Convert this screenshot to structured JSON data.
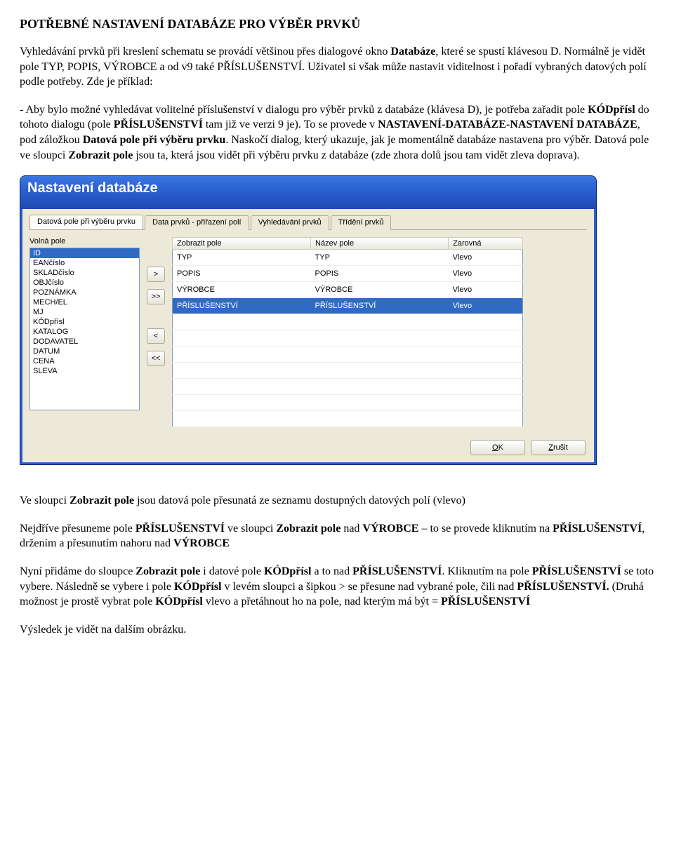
{
  "doc": {
    "title": "POTŘEBNÉ NASTAVENÍ DATABÁZE PRO VÝBĚR PRVKŮ",
    "p1a": "Vyhledávání prvků při kreslení schematu se provádí většinou přes dialogové okno ",
    "p1b": "Databáze",
    "p1c": ", které se spustí klávesou D. Normálně je vidět pole TYP, POPIS, VÝROBCE a od v9 také PŘÍSLUŠENSTVÍ. Uživatel si však může nastavit viditelnost i pořadí vybraných datových polí podle potřeby. Zde je příklad:",
    "p2a": "- Aby bylo možné vyhledávat volitelné příslušenství v dialogu pro výběr prvků z databáze (klávesa D), je potřeba zařadit pole ",
    "p2b": "KÓDpřísl",
    "p2c": "  do tohoto dialogu (pole ",
    "p2d": "PŘÍSLUŠENSTVÍ",
    "p2e": " tam již ve verzi 9 je). To se provede v ",
    "p2f": "NASTAVENÍ-DATABÁZE-NASTAVENÍ DATABÁZE",
    "p2g": ", pod záložkou ",
    "p2h": "Datová pole při výběru prvku",
    "p2i": ". Naskočí dialog, který ukazuje, jak je momentálně databáze nastavena pro výběr. Datová pole ve sloupci ",
    "p2j": "Zobrazit pole",
    "p2k": " jsou ta, která jsou vidět při výběru prvku z databáze (zde zhora dolů jsou tam vidět zleva doprava).",
    "p3a": "Ve sloupci ",
    "p3b": "Zobrazit pole",
    "p3c": " jsou datová pole přesunatá ze seznamu dostupných datových polí (vlevo)",
    "p4a": "Nejdříve přesuneme pole ",
    "p4b": "PŘÍSLUŠENSTVÍ",
    "p4c": " ve sloupci ",
    "p4d": "Zobrazit pole",
    "p4e": " nad ",
    "p4f": "VÝROBCE",
    "p4g": " – to se provede kliknutím na ",
    "p4h": "PŘÍSLUŠENSTVÍ",
    "p4i": ", držením a přesunutím nahoru nad ",
    "p4j": "VÝROBCE",
    "p5a": "Nyní přidáme do sloupce ",
    "p5b": "Zobrazit pole",
    "p5c": " i datové pole ",
    "p5d": "KÓDpřísl",
    "p5e": "  a to nad ",
    "p5f": "PŘÍSLUŠENSTVÍ",
    "p5g": ".  Kliknutím na pole ",
    "p5h": "PŘÍSLUŠENSTVÍ",
    "p5i": " se toto vybere. Následně se vybere i pole ",
    "p5j": "KÓDpřísl",
    "p5k": " v levém sloupci a šipkou >  se přesune nad vybrané pole, čili nad ",
    "p5l": "PŘÍSLUŠENSTVÍ.",
    "p5m": " (Druhá možnost je prostě vybrat pole ",
    "p5n": "KÓDpřísl",
    "p5o": " vlevo a přetáhnout ho na pole, nad kterým má být = ",
    "p5p": "PŘÍSLUŠENSTVÍ",
    "p6": "Výsledek je vidět na dalším obrázku."
  },
  "dialog": {
    "title": "Nastavení databáze",
    "tabs": [
      "Datová pole při výběru prvku",
      "Data prvků - přiřazení polí",
      "Vyhledávání prvků",
      "Třídění prvků"
    ],
    "leftLabel": "Volná pole",
    "leftItems": [
      "ID",
      "EANčíslo",
      "SKLADčíslo",
      "OBJčíslo",
      "POZNÁMKA",
      "MECH/EL",
      "MJ",
      "KÓDpřísl",
      "KATALOG",
      "DODAVATEL",
      "DATUM",
      "CENA",
      "SLEVA"
    ],
    "leftSelected": "ID",
    "arrows": {
      "add": ">",
      "addAll": ">>",
      "remove": "<",
      "removeAll": "<<"
    },
    "cols": {
      "c1": "Zobrazit pole",
      "c2": "Název pole",
      "c3": "Zarovná"
    },
    "rows": [
      {
        "show": "TYP",
        "name": "TYP",
        "align": "Vlevo"
      },
      {
        "show": "POPIS",
        "name": "POPIS",
        "align": "Vlevo"
      },
      {
        "show": "VÝROBCE",
        "name": "VÝROBCE",
        "align": "Vlevo"
      },
      {
        "show": "PŘÍSLUŠENSTVÍ",
        "name": "PŘÍSLUŠENSTVÍ",
        "align": "Vlevo"
      }
    ],
    "selectedRow": 3,
    "ok": "OK",
    "cancel": "Zrušit"
  }
}
